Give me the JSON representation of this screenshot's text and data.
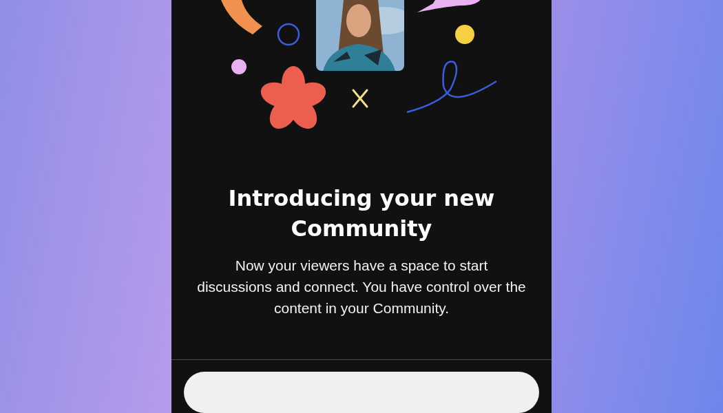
{
  "title": "Introducing your new Community",
  "description": "Now your viewers have a space to start discussions and connect. You have control over the content in your Community."
}
